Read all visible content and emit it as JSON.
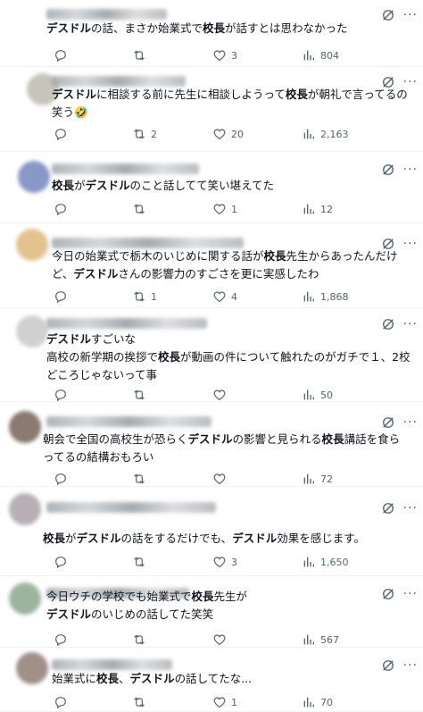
{
  "posts": [
    {
      "text_parts": [
        [
          "デスドル",
          1
        ],
        [
          "の話、まさか始業式で",
          0
        ],
        [
          "校長",
          1
        ],
        [
          "が話すとは思わなかった",
          0
        ]
      ],
      "replies": "",
      "reposts": "",
      "likes": "3",
      "views": "804"
    },
    {
      "text_parts": [
        [
          "デスドル",
          1
        ],
        [
          "に相談する前に先生に相談しようって",
          0
        ],
        [
          "校長",
          1
        ],
        [
          "が朝礼で言ってるの笑う🤣",
          0
        ]
      ],
      "replies": "",
      "reposts": "2",
      "likes": "20",
      "views": "2,163"
    },
    {
      "text_parts": [
        [
          "校長",
          1
        ],
        [
          "が",
          0
        ],
        [
          "デスドル",
          1
        ],
        [
          "のこと話してて笑い堪えてた",
          0
        ]
      ],
      "replies": "",
      "reposts": "",
      "likes": "1",
      "views": "12"
    },
    {
      "text_parts": [
        [
          "今日の始業式で栃木のいじめに関する話が",
          0
        ],
        [
          "校長",
          1
        ],
        [
          "先生からあったんだけど、",
          0
        ],
        [
          "デスドル",
          1
        ],
        [
          "さんの影響力のすごさを更に実感したわ",
          0
        ]
      ],
      "replies": "",
      "reposts": "1",
      "likes": "4",
      "views": "1,868"
    },
    {
      "text_parts": [
        [
          "デスドル",
          1
        ],
        [
          "すごいな\n高校の新学期の挨拶で",
          0
        ],
        [
          "校長",
          1
        ],
        [
          "が動画の件について触れたのがガチで１、2校どころじゃないって事",
          0
        ]
      ],
      "replies": "",
      "reposts": "",
      "likes": "",
      "views": "50"
    },
    {
      "text_parts": [
        [
          "朝会で全国の高校生が恐らく",
          0
        ],
        [
          "デスドル",
          1
        ],
        [
          "の影響と見られる",
          0
        ],
        [
          "校長",
          1
        ],
        [
          "講話を食らってるの結構おもろい",
          0
        ]
      ],
      "replies": "",
      "reposts": "",
      "likes": "",
      "views": "72"
    },
    {
      "text_parts": [
        [
          "校長",
          1
        ],
        [
          "が",
          0
        ],
        [
          "デスドル",
          1
        ],
        [
          "の話をするだけでも、",
          0
        ],
        [
          "デスドル",
          1
        ],
        [
          "効果を感じます。",
          0
        ]
      ],
      "replies": "",
      "reposts": "",
      "likes": "3",
      "views": "1,650"
    },
    {
      "text_parts": [
        [
          "今日ウチの学校でも始業式で",
          0
        ],
        [
          "校長",
          1
        ],
        [
          "先生が\n",
          0
        ],
        [
          "デスドル",
          1
        ],
        [
          "のいじめの話してた笑笑",
          0
        ]
      ],
      "replies": "",
      "reposts": "",
      "likes": "",
      "views": "567"
    },
    {
      "text_parts": [
        [
          "始業式に",
          0
        ],
        [
          "校長",
          1
        ],
        [
          "、",
          0
        ],
        [
          "デスドル",
          1
        ],
        [
          "の話してたな...",
          0
        ]
      ],
      "replies": "",
      "reposts": "",
      "likes": "1",
      "views": "70"
    }
  ],
  "icons": {
    "reply": "reply-icon",
    "repost": "repost-icon",
    "like": "like-icon",
    "views": "views-icon",
    "bookmark": "bookmark-icon",
    "share": "share-icon",
    "grok": "grok-icon",
    "more": "more-icon"
  }
}
